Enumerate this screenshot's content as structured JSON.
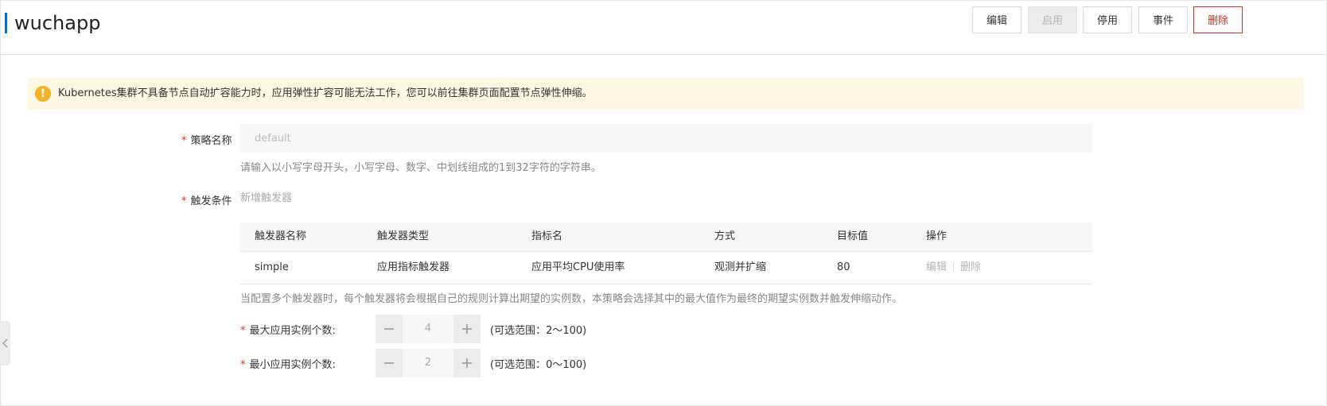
{
  "header": {
    "title": "wuchapp",
    "buttons": {
      "edit": "编辑",
      "enable": "启用",
      "disable": "停用",
      "events": "事件",
      "delete": "删除"
    }
  },
  "alert": {
    "icon": "warning-icon",
    "text": "Kubernetes集群不具备节点自动扩容能力时，应用弹性扩容可能无法工作，您可以前往集群页面配置节点弹性伸缩。"
  },
  "form": {
    "policy_name": {
      "label": "策略名称",
      "value": "default",
      "hint": "请输入以小写字母开头，小写字母、数字、中划线组成的1到32字符的字符串。"
    },
    "trigger": {
      "label": "触发条件",
      "add_label": "新增触发器",
      "columns": [
        "触发器名称",
        "触发器类型",
        "指标名",
        "方式",
        "目标值",
        "操作"
      ],
      "rows": [
        {
          "name": "simple",
          "type": "应用指标触发器",
          "metric": "应用平均CPU使用率",
          "mode": "观测并扩缩",
          "target": "80",
          "edit": "编辑",
          "delete": "删除"
        }
      ],
      "hint": "当配置多个触发器时，每个触发器将会根据自己的规则计算出期望的实例数，本策略会选择其中的最大值作为最终的期望实例数并触发伸缩动作。"
    },
    "max_instances": {
      "label": "最大应用实例个数:",
      "value": "4",
      "range": "(可选范围：2～100)"
    },
    "min_instances": {
      "label": "最小应用实例个数:",
      "value": "2",
      "range": "(可选范围：0～100)"
    }
  },
  "colors": {
    "accent": "#0070cc",
    "danger": "#d93026",
    "warning": "#f5b226",
    "alert_bg": "#fdf7e4"
  }
}
